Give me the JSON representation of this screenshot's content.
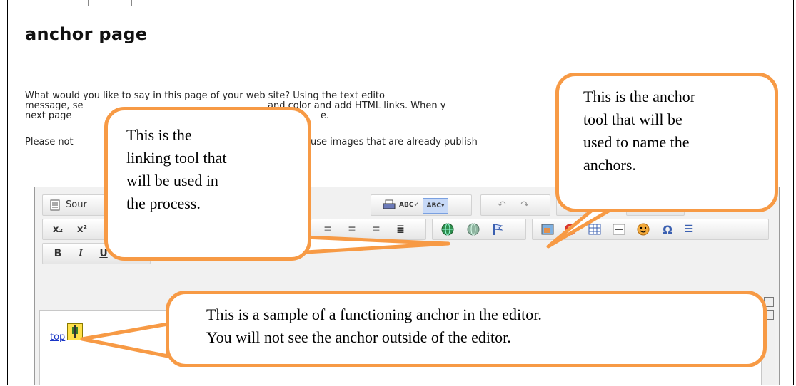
{
  "page": {
    "title": "anchor page",
    "intro_lines": [
      "What would you like to say in this page of your web site? Using the text edito",
      "message, se",
      "next page",
      "Please not"
    ],
    "intro_fragments": {
      "line2_tail": "and color and add HTML links. When y",
      "line3_tail": "e.",
      "line4_tail": "use images that are already publish"
    }
  },
  "editor": {
    "source_label": "Sour",
    "content_link": "top"
  },
  "callouts": {
    "linking_tool": [
      "This is the",
      "linking tool that",
      "will be used in",
      "the process."
    ],
    "anchor_tool": [
      "This is the anchor",
      "tool that will be",
      "used to name the",
      "anchors."
    ],
    "sample_anchor": [
      "This is a sample of a functioning anchor in the editor.",
      "You will not see the anchor outside of the editor."
    ]
  },
  "icons": {
    "row1": [
      "source-icon",
      "print-icon",
      "spellcheck-icon",
      "spellcheck-dropdown-icon",
      "undo-icon",
      "redo-icon",
      "find-icon",
      "select-all-icon"
    ],
    "row2": [
      "subscript-icon",
      "superscript-icon",
      "numbered-list-icon",
      "bulleted-list-icon",
      "outdent-icon",
      "indent-icon",
      "blockquote-icon",
      "div-icon",
      "align-left-icon",
      "align-center-icon",
      "align-right-icon",
      "justify-icon",
      "link-icon",
      "unlink-icon",
      "anchor-icon",
      "image-icon",
      "flash-icon",
      "table-icon",
      "horizontal-rule-icon",
      "smiley-icon",
      "special-char-icon",
      "page-break-icon"
    ],
    "row3": [
      "bold-icon",
      "italic-icon",
      "underline-icon",
      "strikethrough-icon"
    ]
  },
  "colors": {
    "callout_border": "#f79a45",
    "link": "#1a36c7"
  }
}
